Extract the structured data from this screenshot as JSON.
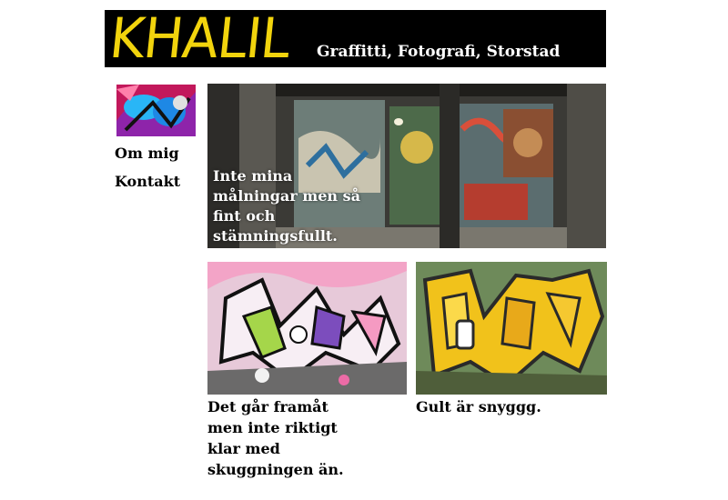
{
  "header": {
    "logo": "KHALIL",
    "tagline": "Graffitti, Fotografi, Storstad"
  },
  "nav": {
    "about": "Om mig",
    "contact": "Kontakt"
  },
  "hero": {
    "caption": "Inte mina målningar men så fint och stämningsfullt."
  },
  "gallery": {
    "left_caption": "Det går framåt men inte riktigt klar med skuggningen än.",
    "right_caption": "Gult är snyggg."
  },
  "colors": {
    "header_bg": "#000000",
    "logo_yellow": "#f2d40d",
    "background": "#ffffff"
  }
}
